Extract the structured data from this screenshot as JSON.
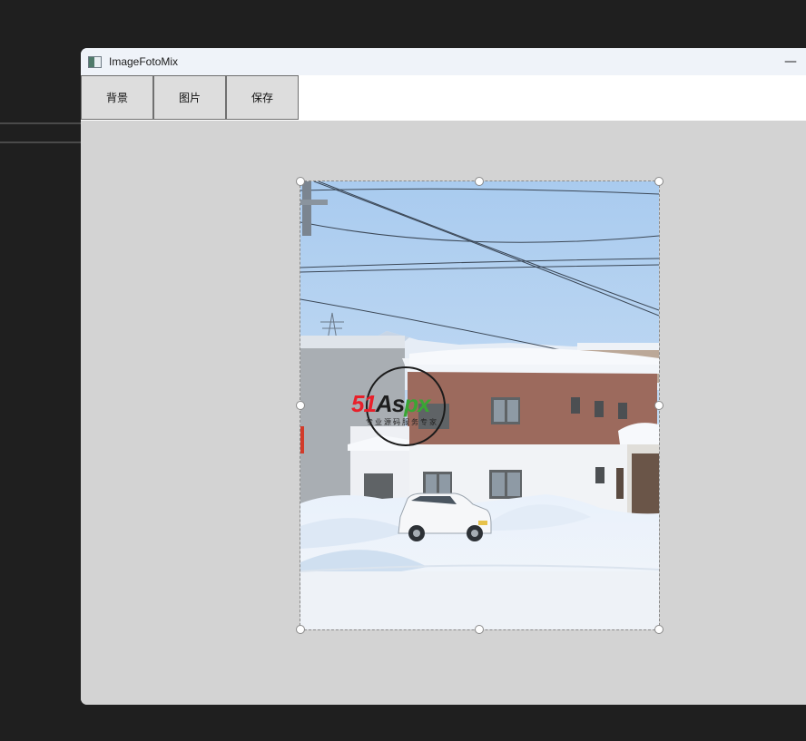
{
  "window": {
    "title": "ImageFotoMix",
    "minimize_glyph": "—",
    "app_icon": "image-app-icon"
  },
  "toolbar": {
    "buttons": [
      {
        "label": "背景"
      },
      {
        "label": "图片"
      },
      {
        "label": "保存"
      }
    ]
  },
  "canvas": {
    "photo": "snowy-street-house-with-white-car",
    "watermark": {
      "logo_part1": "51",
      "logo_part2": "As",
      "logo_part3": "px",
      "subtitle": "专业源码服务专家"
    }
  }
}
